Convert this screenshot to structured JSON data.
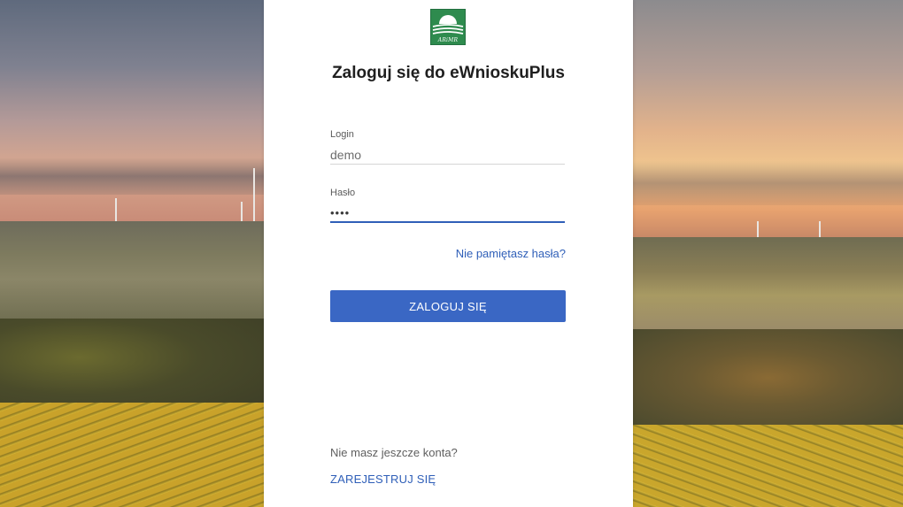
{
  "logo": {
    "text": "ARiMR",
    "color": "#2e8b4e"
  },
  "form": {
    "title": "Zaloguj się do eWnioskuPlus",
    "login": {
      "label": "Login",
      "value": "demo"
    },
    "password": {
      "label": "Hasło",
      "value": "••••"
    },
    "forgot_link": "Nie pamiętasz hasła?",
    "submit_label": "ZALOGUJ SIĘ",
    "no_account_text": "Nie masz jeszcze konta?",
    "register_link": "ZAREJESTRUJ SIĘ"
  },
  "colors": {
    "accent": "#3a67c4",
    "link": "#2f5fb8",
    "card_background": "#ffffff"
  },
  "background": {
    "scene": "landscape-photo"
  }
}
